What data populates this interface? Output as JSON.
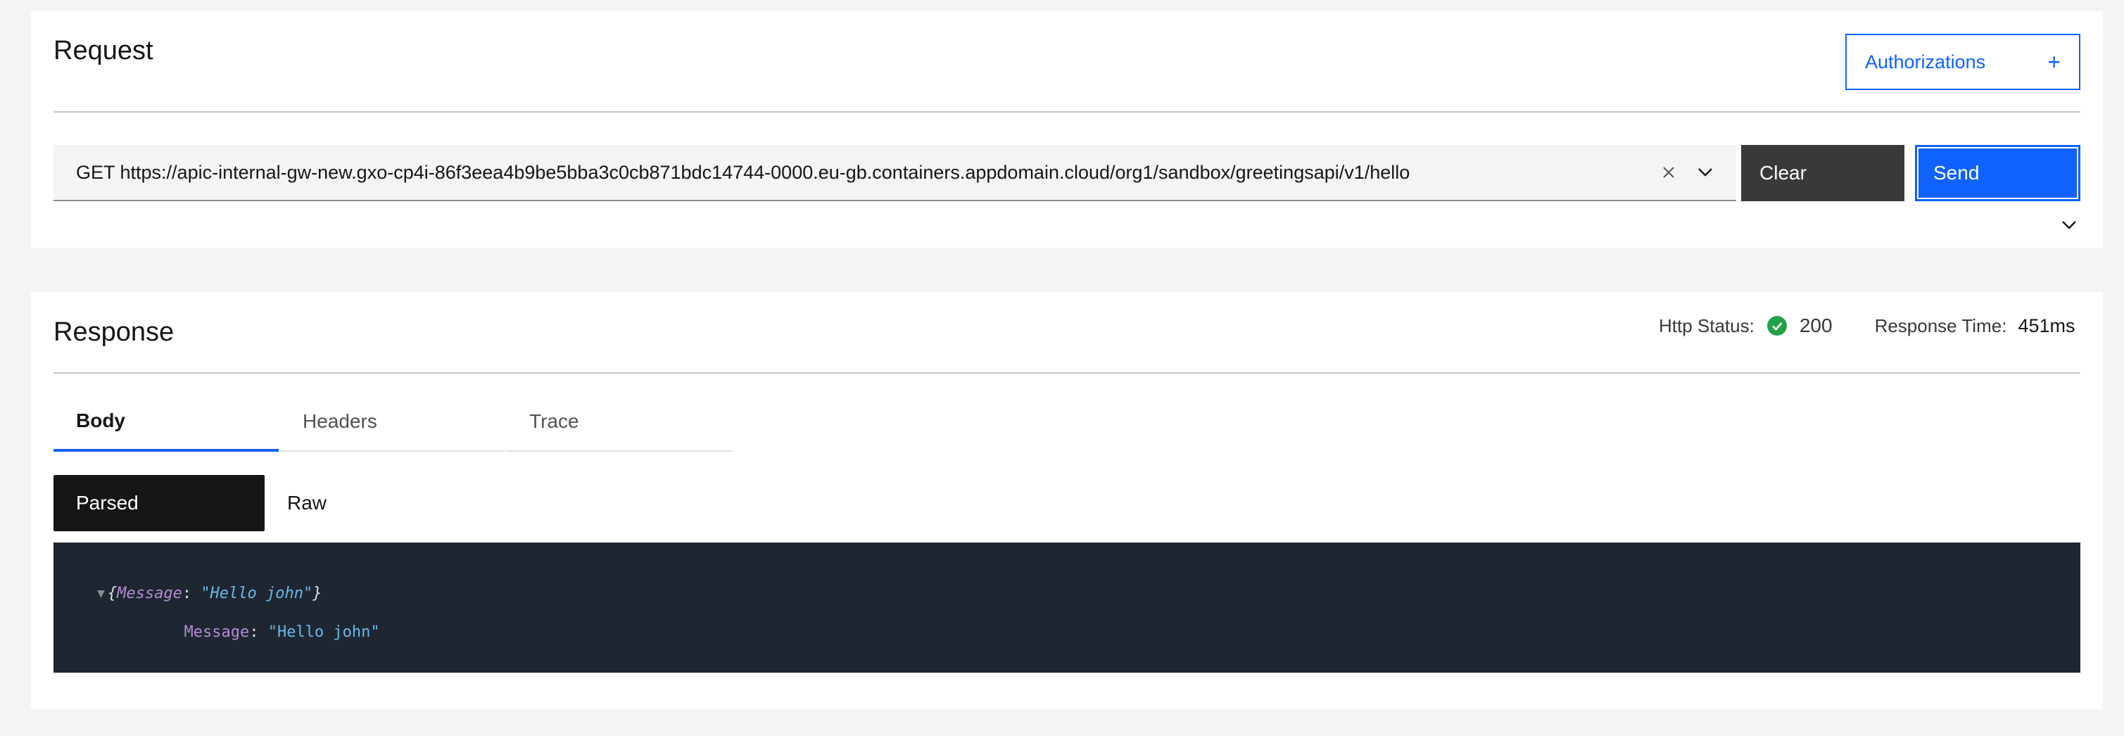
{
  "request": {
    "title": "Request",
    "authorizations_label": "Authorizations",
    "authorizations_icon": "plus-icon",
    "url_value": "GET https://apic-internal-gw-new.gxo-cp4i-86f3eea4b9be5bba3c0cb871bdc14744-0000.eu-gb.containers.appdomain.cloud/org1/sandbox/greetingsapi/v1/hello",
    "clear_label": "Clear",
    "send_label": "Send"
  },
  "response": {
    "title": "Response",
    "http_status_label": "Http Status:",
    "http_status_value": "200",
    "http_status_color": "#24a148",
    "response_time_label": "Response Time:",
    "response_time_value": "451ms",
    "tabs": [
      {
        "label": "Body",
        "active": true
      },
      {
        "label": "Headers",
        "active": false
      },
      {
        "label": "Trace",
        "active": false
      }
    ],
    "view_modes": [
      {
        "label": "Parsed",
        "active": true
      },
      {
        "label": "Raw",
        "active": false
      }
    ],
    "body": {
      "open_brace": "{",
      "key": "Message",
      "colon": ": ",
      "value": "\"Hello john\"",
      "close_brace": "}",
      "expanded_key": "Message",
      "expanded_colon": ": ",
      "expanded_value": "\"Hello john\""
    }
  },
  "colors": {
    "accent": "#0f62fe",
    "code_background": "#1e2731"
  }
}
